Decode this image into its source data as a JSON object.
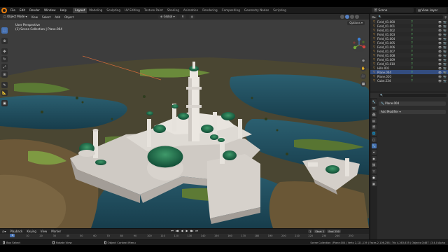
{
  "menubar": {
    "items": [
      "File",
      "Edit",
      "Render",
      "Window",
      "Help"
    ],
    "workspaces": [
      "Layout",
      "Modeling",
      "Sculpting",
      "UV Editing",
      "Texture Paint",
      "Shading",
      "Animation",
      "Rendering",
      "Compositing",
      "Geometry Nodes",
      "Scripting"
    ],
    "active_workspace": "Layout",
    "scene": "Scene",
    "view_layer": "View Layer"
  },
  "viewport": {
    "mode": "Object Mode",
    "menus": [
      "View",
      "Select",
      "Add",
      "Object"
    ],
    "transform_orientation": "Global",
    "options_label": "Options",
    "info_line1": "User Perspective",
    "info_line2": "(1) Scene Collection | Plane.004"
  },
  "toolbar": {
    "tools": [
      "select-box",
      "cursor",
      "move",
      "rotate",
      "scale",
      "transform",
      "annotate",
      "measure",
      "add-cube"
    ],
    "active": "select-box"
  },
  "navigation": [
    "zoom",
    "pan",
    "camera",
    "perspective"
  ],
  "outliner": {
    "search_placeholder": "",
    "rows": [
      {
        "name": "Field_01.000",
        "selected": false
      },
      {
        "name": "Field_01.001",
        "selected": false
      },
      {
        "name": "Field_01.002",
        "selected": false
      },
      {
        "name": "Field_01.003",
        "selected": false
      },
      {
        "name": "Field_01.004",
        "selected": false
      },
      {
        "name": "Field_01.005",
        "selected": false
      },
      {
        "name": "Field_01.006",
        "selected": false
      },
      {
        "name": "Field_01.007",
        "selected": false
      },
      {
        "name": "Field_01.008",
        "selected": false
      },
      {
        "name": "Field_01.009",
        "selected": false
      },
      {
        "name": "Field_01.010",
        "selected": false
      },
      {
        "name": "Hills.001",
        "selected": false
      },
      {
        "name": "Plane.004",
        "selected": true
      },
      {
        "name": "Plane.010",
        "selected": false
      },
      {
        "name": "Cube.234",
        "selected": false
      }
    ]
  },
  "properties": {
    "object_name": "Plane.004",
    "add_modifier": "Add Modifier",
    "tabs": [
      "tool",
      "render",
      "output",
      "view-layer",
      "scene",
      "world",
      "object",
      "modifier",
      "particles",
      "physics",
      "constraints",
      "data",
      "material",
      "texture"
    ],
    "active_tab": "modifier"
  },
  "timeline": {
    "menus": [
      "Playback",
      "Keying",
      "View",
      "Marker"
    ],
    "current_frame": "1",
    "start_label": "Start",
    "start": "1",
    "end_label": "End",
    "end": "250",
    "ticks": [
      "0",
      "10",
      "20",
      "30",
      "40",
      "50",
      "60",
      "70",
      "80",
      "90",
      "100",
      "110",
      "120",
      "130",
      "140",
      "150",
      "160",
      "170",
      "180",
      "190",
      "200",
      "210",
      "220",
      "230",
      "240",
      "250"
    ]
  },
  "statusbar": {
    "select": "Box Select",
    "rotate": "Rotate View",
    "context": "Object Context Menu",
    "stats": "Scene Collection | Plane.004 | Verts 2,121,119 | Faces 2,106,258 | Tris 4,263,635 | Objects 0/467 | 3.4.0 Alpha"
  },
  "colors": {
    "accent": "#4772b3",
    "orange": "#e87d0d",
    "selected_row": "#334d80"
  }
}
